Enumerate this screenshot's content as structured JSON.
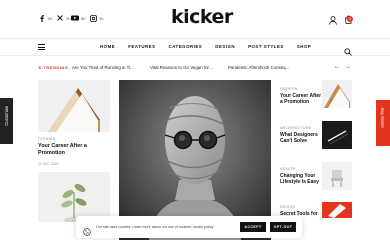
{
  "social": [
    {
      "icon": "facebook-icon",
      "count": "5K"
    },
    {
      "icon": "x-icon",
      "count": "2K"
    },
    {
      "icon": "youtube-icon",
      "count": "8K"
    },
    {
      "icon": "instagram-icon",
      "count": "3K"
    }
  ],
  "logo": "kicker",
  "cart_count": "0",
  "nav": [
    "HOME",
    "FEATURES",
    "CATEGORIES",
    "DESIGN",
    "POST STYLES",
    "SHOP"
  ],
  "trending": {
    "label": "TRENDING",
    "items": [
      "Are You Tired of Running in Ti...",
      "Vital Reasons to Go Vegan for ...",
      "Pandemic Aftershock Conseq..."
    ]
  },
  "left_post": {
    "tag": "FASHION",
    "title_1": "Your Career After a",
    "title_2": "Promotion",
    "date": "20 DEC 2023"
  },
  "right_posts": [
    {
      "tag": "FASHION",
      "title_1": "Your Career After",
      "title_2": "a Promotion"
    },
    {
      "tag": "ARCHITECTURE",
      "title_1": "What Designers",
      "title_2": "Can't Solve"
    },
    {
      "tag": "HEALTH",
      "title_1": "Changing Your",
      "title_2": "Lifestyle Is Easy"
    },
    {
      "tag": "DESIGN",
      "title_1": "Secret Tools for",
      "title_2": ""
    }
  ],
  "side_left": "Customize",
  "side_right": "Buy Kicker",
  "cookie": {
    "text": "Our site uses cookies. Learn more about our use of cookies: cookie policy",
    "accept": "ACCEPT",
    "optout": "OPT-OUT"
  },
  "colors": {
    "accent": "#e3351d"
  }
}
